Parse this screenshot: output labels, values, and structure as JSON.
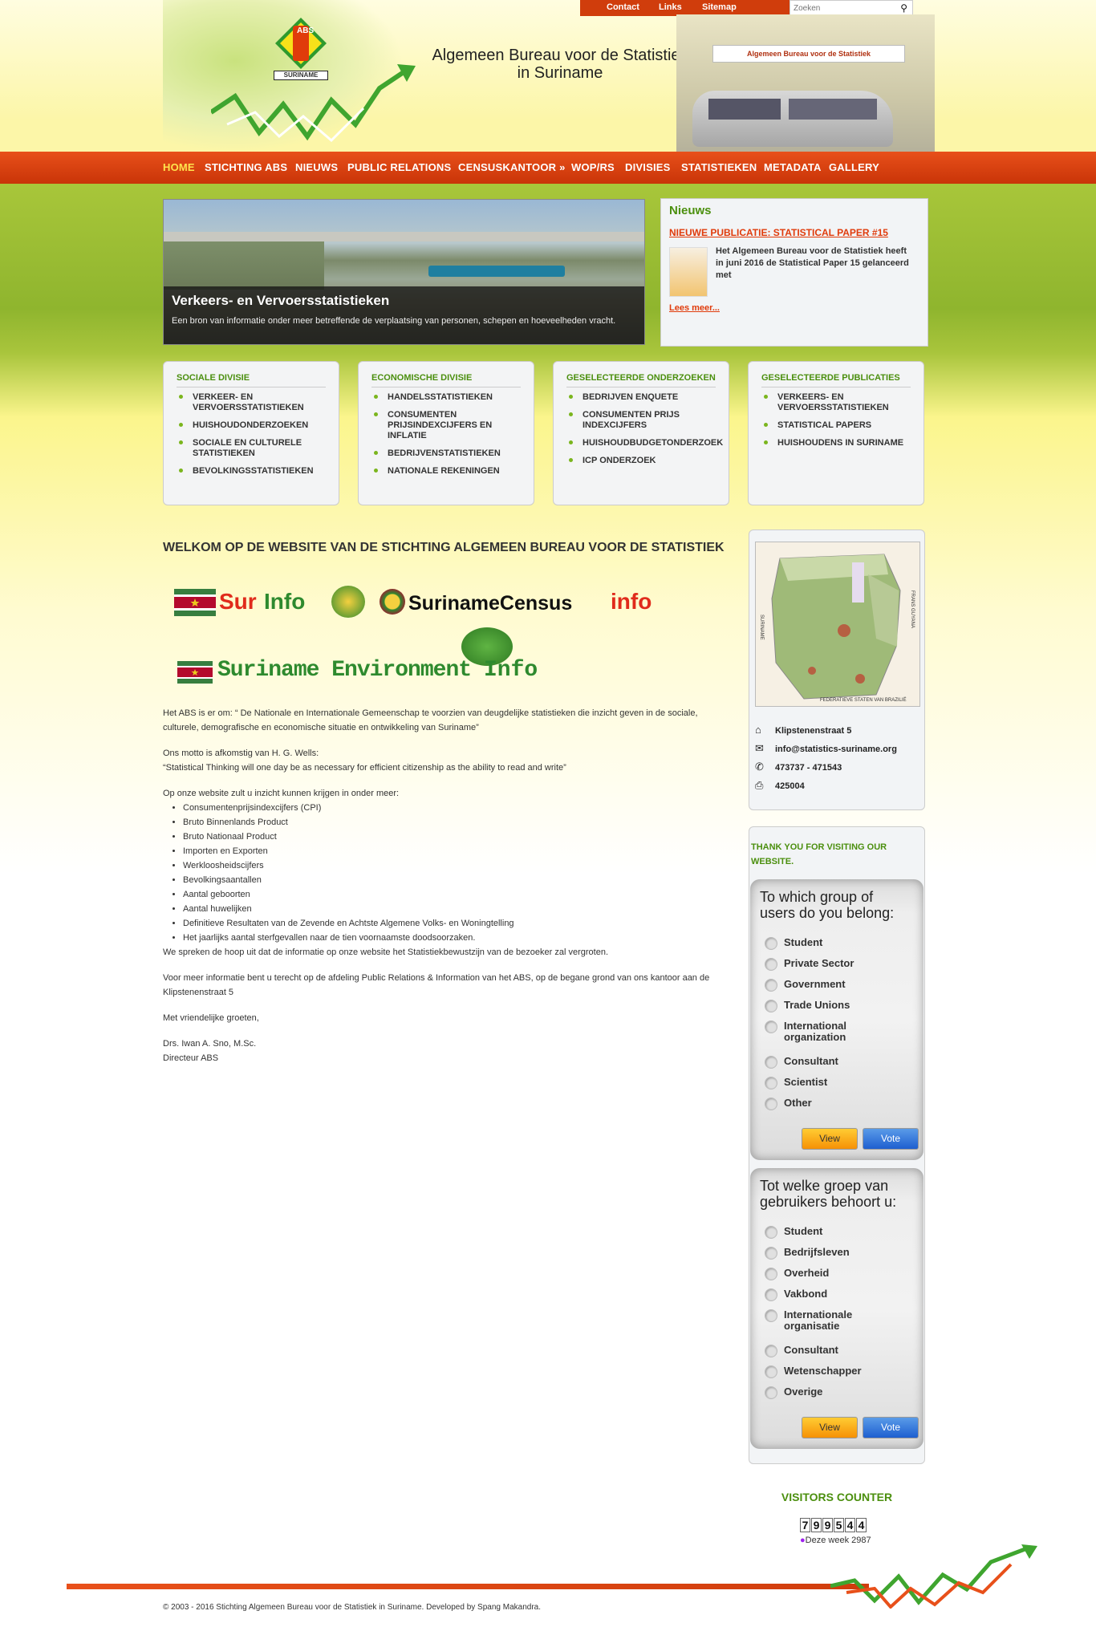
{
  "topbar": {
    "links": [
      "Contact",
      "Links",
      "Sitemap"
    ],
    "search_placeholder": "Zoeken"
  },
  "header": {
    "title_line1": "Algemeen Bureau voor de Statistiek",
    "title_line2": "in Suriname",
    "logo_text_top": "ABS",
    "logo_text_bottom": "SURINAME",
    "building_sign": "Algemeen Bureau voor de Statistiek"
  },
  "nav": {
    "items": [
      "HOME",
      "STICHTING ABS",
      "NIEUWS",
      "PUBLIC RELATIONS",
      "CENSUSKANTOOR »",
      "WOP/RS",
      "DIVISIES",
      "STATISTIEKEN",
      "METADATA",
      "GALLERY"
    ],
    "active": "HOME"
  },
  "slider": {
    "title": "Verkeers- en Vervoersstatistieken",
    "text": "Een bron van informatie onder meer betreffende de verplaatsing van personen, schepen en hoeveelheden vracht."
  },
  "news": {
    "heading": "Nieuws",
    "headline": "NIEUWE PUBLICATIE: STATISTICAL PAPER #15",
    "body": "Het Algemeen Bureau voor de Statistiek heeft in juni 2016 de Statistical Paper 15 gelanceerd met",
    "more": "Lees meer..."
  },
  "boxes": [
    {
      "title": "SOCIALE DIVISIE",
      "items": [
        "VERKEER- EN VERVOERSSTATISTIEKEN",
        "HUISHOUDONDERZOEKEN",
        "SOCIALE EN CULTURELE STATISTIEKEN",
        "BEVOLKINGSSTATISTIEKEN"
      ]
    },
    {
      "title": "ECONOMISCHE DIVISIE",
      "items": [
        "HANDELSSTATISTIEKEN",
        "CONSUMENTEN PRIJSINDEXCIJFERS EN INFLATIE",
        "BEDRIJVENSTATISTIEKEN",
        "NATIONALE REKENINGEN"
      ]
    },
    {
      "title": "GESELECTEERDE ONDERZOEKEN",
      "items": [
        "BEDRIJVEN ENQUETE",
        "CONSUMENTEN PRIJS INDEXCIJFERS",
        "HUISHOUDBUDGETONDERZOEK",
        "ICP ONDERZOEK"
      ]
    },
    {
      "title": "GESELECTEERDE PUBLICATIES",
      "items": [
        "VERKEERS- EN VERVOERSSTATISTIEKEN",
        "STATISTICAL PAPERS",
        "HUISHOUDENS IN SURINAME"
      ]
    }
  ],
  "main": {
    "heading": "WELKOM OP DE WEBSITE VAN DE STICHTING ALGEMEEN BUREAU VOOR DE STATISTIEK",
    "logo1_a": "Sur",
    "logo1_b": "Info",
    "logo2_a": "SurinameCensus",
    "logo2_b": "info",
    "logo3_a": "Suriname Environment ",
    "logo3_b": "Info",
    "p1": "Het ABS is er om: “ De Nationale en Internationale Gemeenschap te voorzien van deugdelijke statistieken die inzicht geven in de sociale, culturele, demografische en economische situatie en ontwikkeling van Suriname”",
    "p2a": "Ons motto is afkomstig van H. G. Wells:",
    "p2b": "“Statistical Thinking will one day be as necessary for efficient citizenship as the ability to read and write”",
    "p3": "Op onze website zult u inzicht kunnen krijgen in onder meer:",
    "list": [
      "Consumentenprijsindexcijfers (CPI)",
      "Bruto Binnenlands Product",
      "Bruto Nationaal Product",
      "Importen en Exporten",
      "Werkloosheidscijfers",
      "Bevolkingsaantallen",
      "Aantal geboorten",
      "Aantal huwelijken",
      "Definitieve Resultaten van de Zevende en Achtste Algemene Volks- en Woningtelling",
      "Het jaarlijks aantal sterfgevallen naar de tien voornaamste doodsoorzaken."
    ],
    "p4": "We spreken de hoop uit dat de informatie op onze website het Statistiekbewustzijn van de bezoeker zal vergroten.",
    "p5": "Voor meer informatie bent u terecht op de afdeling Public Relations & Information van het ABS, op de begane grond van ons kantoor aan de Klipstenenstraat 5",
    "p6": "Met vriendelijke groeten,",
    "sig1": "Drs. Iwan A. Sno, M.Sc.",
    "sig2": "Directeur ABS"
  },
  "contact": {
    "address": "Klipstenenstraat 5",
    "email": "info@statistics-suriname.org",
    "phone": "473737 - 471543",
    "fax": "425004",
    "map_label_left": "SURINAME",
    "map_label_right": "FRANS GUYANA",
    "map_label_bottom": "FEDERATIEVE STATEN VAN BRAZILIË"
  },
  "visit": {
    "heading": "THANK YOU FOR VISITING OUR WEBSITE."
  },
  "poll_en": {
    "question": "To which group of users do you belong:",
    "options": [
      "Student",
      "Private Sector",
      "Government",
      "Trade Unions",
      "International organization",
      "Consultant",
      "Scientist",
      "Other"
    ],
    "view": "View",
    "vote": "Vote"
  },
  "poll_nl": {
    "question": "Tot welke groep van gebruikers behoort u:",
    "options": [
      "Student",
      "Bedrijfsleven",
      "Overheid",
      "Vakbond",
      "Internationale organisatie",
      "Consultant",
      "Wetenschapper",
      "Overige"
    ],
    "view": "View",
    "vote": "Vote"
  },
  "counter": {
    "heading": "VISITORS COUNTER",
    "digits": [
      "7",
      "9",
      "9",
      "5",
      "4",
      "4"
    ],
    "week": "Deze week 2987"
  },
  "footer": {
    "text": "© 2003 - 2016 Stichting Algemeen Bureau voor de Statistiek in Suriname. Developed by Spang Makandra."
  },
  "colors": {
    "accent_red": "#d03d0c",
    "accent_green": "#4b8f0e",
    "nav_active": "#ffe44d"
  }
}
